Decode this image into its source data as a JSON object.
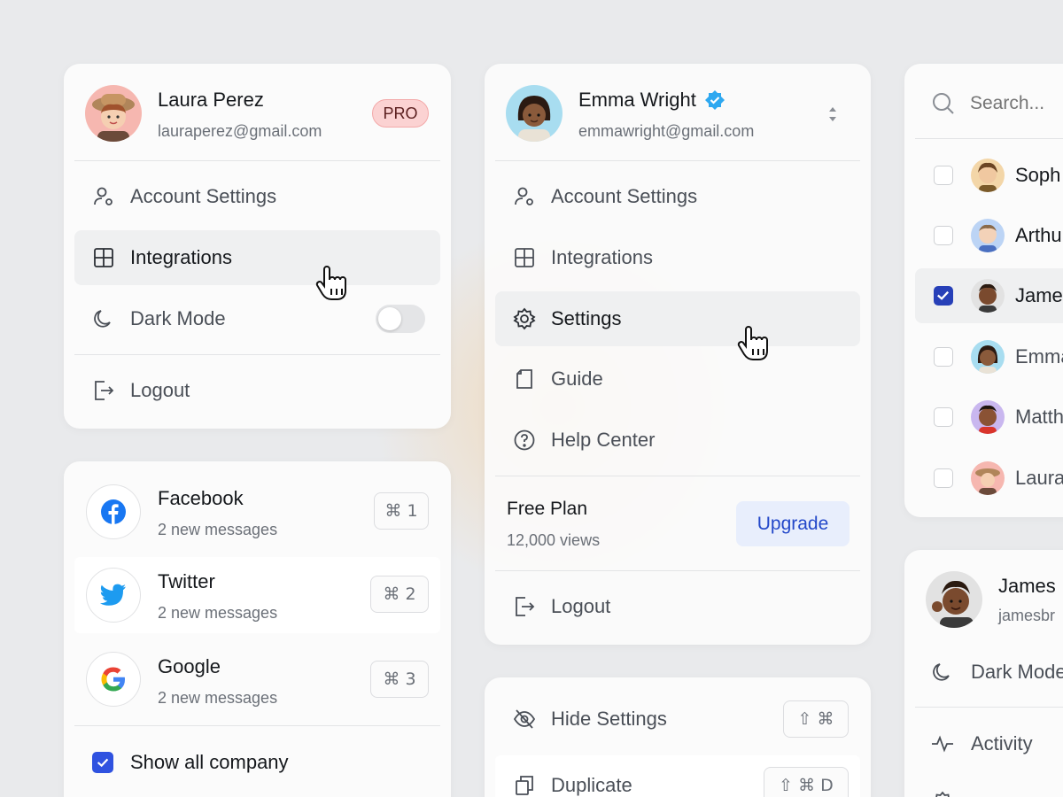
{
  "profile_card_1": {
    "name": "Laura Perez",
    "email": "lauraperez@gmail.com",
    "badge": "PRO",
    "menu": [
      {
        "label": "Account Settings",
        "icon": "user-gear-icon"
      },
      {
        "label": "Integrations",
        "icon": "grid-icon"
      },
      {
        "label": "Dark Mode",
        "icon": "moon-icon"
      }
    ],
    "dark_mode_on": false,
    "logout": "Logout"
  },
  "profile_card_2": {
    "name": "Emma Wright",
    "email": "emmawright@gmail.com",
    "verified": true,
    "menu": [
      {
        "label": "Account Settings",
        "icon": "user-gear-icon"
      },
      {
        "label": "Integrations",
        "icon": "grid-icon"
      },
      {
        "label": "Settings",
        "icon": "gear-icon"
      },
      {
        "label": "Guide",
        "icon": "document-icon"
      },
      {
        "label": "Help Center",
        "icon": "help-icon"
      }
    ],
    "plan": {
      "title": "Free Plan",
      "views": "12,000 views",
      "upgrade": "Upgrade"
    },
    "logout": "Logout"
  },
  "people_picker": {
    "search_placeholder": "Search...",
    "people": [
      {
        "name": "Soph",
        "checked": false
      },
      {
        "name": "Arthu",
        "checked": false
      },
      {
        "name": "Jame",
        "checked": true
      },
      {
        "name": "Emma",
        "checked": false
      },
      {
        "name": "Matth",
        "checked": false
      },
      {
        "name": "Laura",
        "checked": false
      }
    ]
  },
  "messages_card": {
    "items": [
      {
        "name": "Facebook",
        "sub": "2 new messages",
        "key": "1",
        "icon": "facebook-icon"
      },
      {
        "name": "Twitter",
        "sub": "2 new messages",
        "key": "2",
        "icon": "twitter-icon"
      },
      {
        "name": "Google",
        "sub": "2 new messages",
        "key": "3",
        "icon": "google-icon"
      }
    ],
    "show_all": "Show all company",
    "show_all_checked": true
  },
  "actions_card": {
    "items": [
      {
        "label": "Hide Settings",
        "shortcut_mod": "⇧ ⌘",
        "icon": "eye-off-icon"
      },
      {
        "label": "Duplicate",
        "shortcut_mod": "⇧ ⌘ D",
        "icon": "copy-icon"
      }
    ]
  },
  "profile_card_3": {
    "name": "James",
    "email": "jamesbr",
    "menu": [
      {
        "label": "Dark Mode",
        "icon": "moon-icon"
      },
      {
        "label": "Activity",
        "icon": "activity-icon"
      }
    ]
  },
  "cmd_symbol": "⌘",
  "colors": {
    "accent": "#2740b8",
    "pro_bg": "#fbd2d2",
    "upgrade_bg": "#e8eefc",
    "verified": "#2ea8f0"
  }
}
